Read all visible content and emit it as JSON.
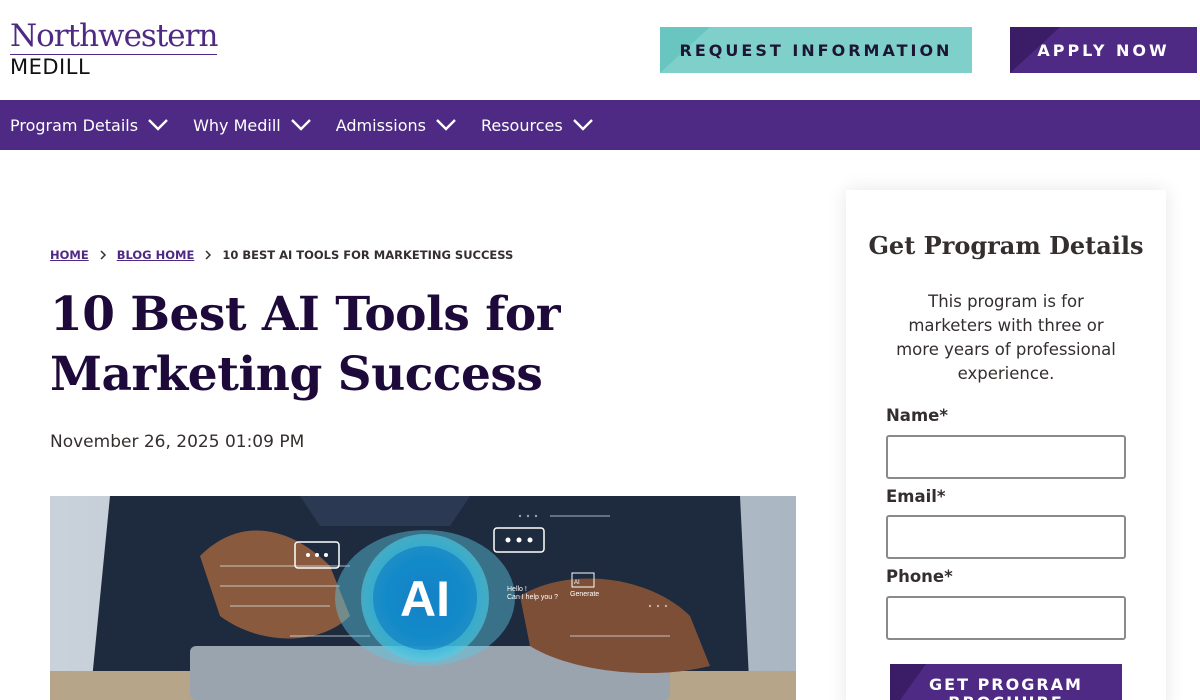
{
  "header": {
    "logo_top": "Northwestern",
    "logo_bottom": "MEDILL",
    "request_button": "REQUEST INFORMATION",
    "apply_button": "APPLY NOW"
  },
  "nav": {
    "items": [
      {
        "label": "Program Details"
      },
      {
        "label": "Why Medill"
      },
      {
        "label": "Admissions"
      },
      {
        "label": "Resources"
      }
    ]
  },
  "breadcrumb": {
    "home": "HOME",
    "blog_home": "BLOG HOME",
    "current": "10 BEST AI TOOLS FOR MARKETING SUCCESS"
  },
  "article": {
    "title": "10 Best AI Tools for Marketing Success",
    "date": "November 26, 2025 01:09 PM",
    "hero_image": {
      "center_label": "AI",
      "chat_text_1": "Hello !",
      "chat_text_2": "Can I help you ?",
      "generate_label": "Generate",
      "small_ai": "AI"
    }
  },
  "form": {
    "title": "Get Program Details",
    "description": "This program is for marketers with three or more years of professional experience.",
    "name_label": "Name*",
    "email_label": "Email*",
    "phone_label": "Phone*",
    "submit_label": "GET PROGRAM BROCHURE"
  },
  "colors": {
    "brand_purple": "#4e2a84",
    "teal": "#7fd0cb",
    "title_dark": "#1d0a3a"
  }
}
